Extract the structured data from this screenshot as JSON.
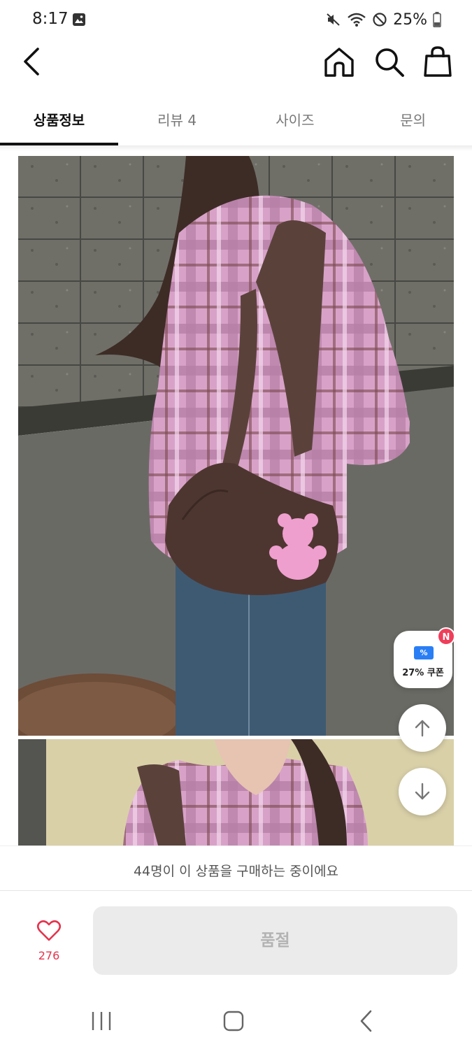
{
  "status_bar": {
    "time": "8:17",
    "battery": "25%",
    "icons": [
      "image-icon",
      "mute-icon",
      "wifi-icon",
      "do-not-disturb-icon",
      "battery-icon"
    ]
  },
  "app_bar": {
    "icons": [
      "back-icon",
      "home-icon",
      "search-icon",
      "shopping-bag-icon"
    ]
  },
  "tabs": [
    {
      "label": "상품정보",
      "active": true
    },
    {
      "label": "리뷰 4",
      "active": false
    },
    {
      "label": "사이즈",
      "active": false
    },
    {
      "label": "문의",
      "active": false
    }
  ],
  "floating": {
    "coupon_label": "27% 쿠폰",
    "coupon_ticket_symbol": "%",
    "new_badge": "N"
  },
  "buying_notice": "44명이 이 상품을 구매하는 중이에요",
  "action": {
    "like_count": "276",
    "soldout_label": "품절"
  },
  "colors": {
    "accent_red": "#e5334d",
    "coupon_blue": "#2a7ef5",
    "badge_red": "#ef3e5a",
    "disabled_bg": "#ebebeb"
  }
}
